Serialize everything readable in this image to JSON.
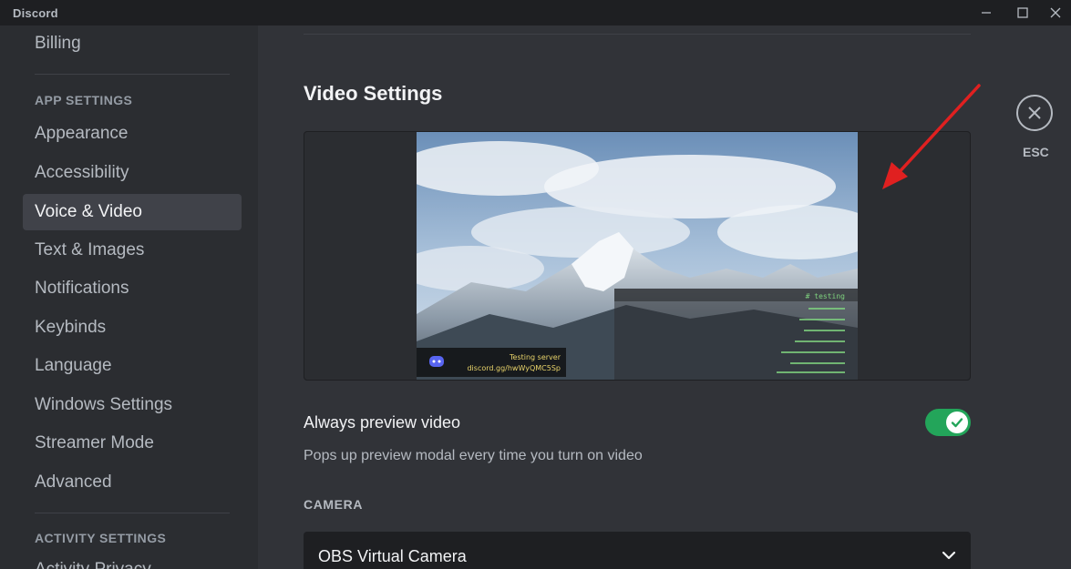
{
  "window": {
    "title": "Discord"
  },
  "sidebar": {
    "items_top": [
      {
        "label": "Billing"
      }
    ],
    "headers": {
      "app_settings": "APP SETTINGS",
      "activity_settings": "ACTIVITY SETTINGS"
    },
    "app_items": [
      {
        "label": "Appearance"
      },
      {
        "label": "Accessibility"
      },
      {
        "label": "Voice & Video",
        "selected": true
      },
      {
        "label": "Text & Images"
      },
      {
        "label": "Notifications"
      },
      {
        "label": "Keybinds"
      },
      {
        "label": "Language"
      },
      {
        "label": "Windows Settings"
      },
      {
        "label": "Streamer Mode"
      },
      {
        "label": "Advanced"
      }
    ],
    "activity_items": [
      {
        "label": "Activity Privacy"
      }
    ]
  },
  "main": {
    "section_title": "Video Settings",
    "preview": {
      "overlay_server_line": "Testing server",
      "overlay_invite_line": "discord.gg/hwWyQMC5Sp",
      "overlay_channel": "# testing"
    },
    "always_preview": {
      "title": "Always preview video",
      "description": "Pops up preview modal every time you turn on video",
      "enabled": true
    },
    "camera": {
      "header": "CAMERA",
      "selected": "OBS Virtual Camera"
    }
  },
  "close": {
    "label": "ESC"
  },
  "colors": {
    "accent_green": "#23a55a",
    "annotation_red": "#e02020"
  },
  "icons": {
    "close": "close-icon",
    "check": "check-icon",
    "chevron": "chevron-down-icon",
    "discord": "discord-logo-icon"
  }
}
